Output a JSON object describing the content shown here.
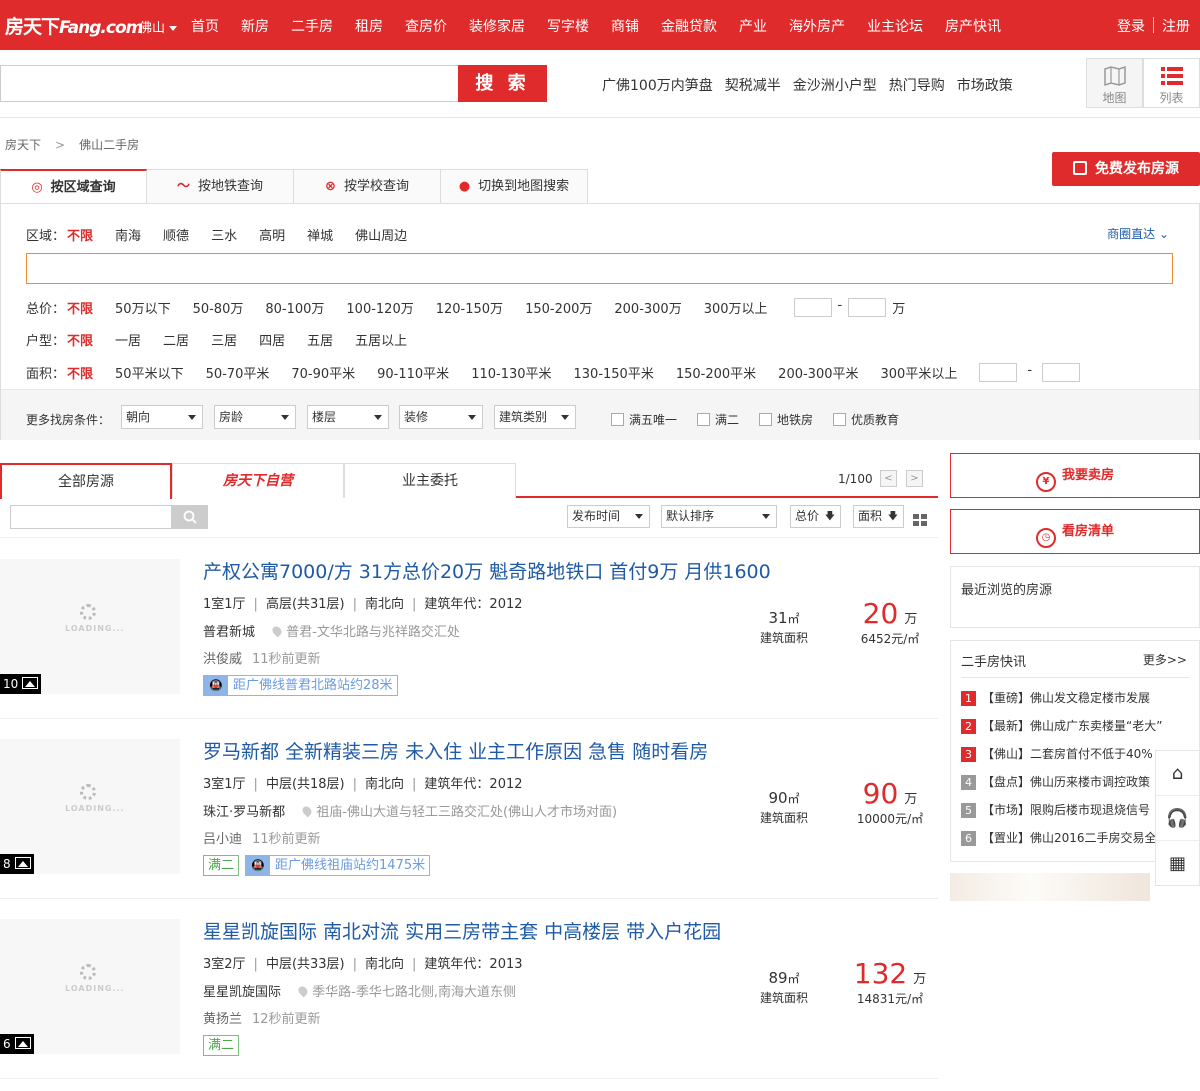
{
  "header": {
    "logo_main": "房天下",
    "logo_sub": "Fang.com",
    "city": "佛山",
    "nav": [
      "首页",
      "新房",
      "二手房",
      "租房",
      "查房价",
      "装修家居",
      "写字楼",
      "商铺",
      "金融贷款",
      "产业",
      "海外房产",
      "业主论坛",
      "房产快讯"
    ],
    "login": "登录",
    "register": "注册"
  },
  "search": {
    "placeholder": "",
    "button": "搜 索",
    "hot_links": [
      "广佛100万内笋盘",
      "契税减半",
      "金沙洲小户型",
      "热门导购",
      "市场政策"
    ],
    "view_map": "地图",
    "view_list": "列表"
  },
  "breadcrumb": [
    "房天下",
    "佛山二手房"
  ],
  "publish_button": "免费发布房源",
  "search_tabs": [
    "按区域查询",
    "按地铁查询",
    "按学校查询",
    "切换到地图搜索"
  ],
  "filters": {
    "district": {
      "label": "区域：",
      "options": [
        "不限",
        "南海",
        "顺德",
        "三水",
        "高明",
        "禅城",
        "佛山周边"
      ]
    },
    "shangquan": "商圈直达",
    "price": {
      "label": "总价：",
      "options": [
        "不限",
        "50万以下",
        "50-80万",
        "80-100万",
        "100-120万",
        "120-150万",
        "150-200万",
        "200-300万",
        "300万以上"
      ],
      "unit": "万",
      "dash": "-"
    },
    "layout": {
      "label": "户型：",
      "options": [
        "不限",
        "一居",
        "二居",
        "三居",
        "四居",
        "五居",
        "五居以上"
      ]
    },
    "area": {
      "label": "面积：",
      "options": [
        "不限",
        "50平米以下",
        "50-70平米",
        "70-90平米",
        "90-110平米",
        "110-130平米",
        "130-150平米",
        "150-200平米",
        "200-300平米",
        "300平米以上"
      ],
      "dash": "-"
    },
    "more_label": "更多找房条件：",
    "dropdowns": [
      "朝向",
      "房龄",
      "楼层",
      "装修",
      "建筑类别"
    ],
    "checkboxes": [
      "满五唯一",
      "满二",
      "地铁房",
      "优质教育"
    ]
  },
  "results": {
    "tabs": [
      "全部房源",
      "房天下自营",
      "业主委托"
    ],
    "pager": "1/100",
    "sort": [
      "发布时间",
      "默认排序",
      "总价",
      "面积"
    ],
    "listings": [
      {
        "title": "产权公寓7000/方 31方总价20万 魁奇路地铁口 首付9万 月供1600",
        "rooms": "1室1厅",
        "floor": "高层(共31层)",
        "facing": "南北向",
        "year": "建筑年代：2012",
        "estate": "普君新城",
        "address": "普君-文华北路与兆祥路交汇处",
        "agent": "洪俊威",
        "updated": "11秒前更新",
        "tags": [
          {
            "text": "距广佛线普君北路站约28米",
            "type": "subway"
          }
        ],
        "area": "31",
        "area_unit": "㎡",
        "area_label": "建筑面积",
        "price": "20",
        "price_unit": "万",
        "unit_price": "6452元/㎡",
        "photos": "10"
      },
      {
        "title": "罗马新都 全新精装三房 未入住 业主工作原因 急售 随时看房",
        "rooms": "3室1厅",
        "floor": "中层(共18层)",
        "facing": "南北向",
        "year": "建筑年代：2012",
        "estate": "珠江·罗马新都",
        "address": "祖庙-佛山大道与轻工三路交汇处(佛山人才市场对面)",
        "agent": "吕小迪",
        "updated": "11秒前更新",
        "tags": [
          {
            "text": "满二",
            "type": "green"
          },
          {
            "text": "距广佛线祖庙站约1475米",
            "type": "subway"
          }
        ],
        "area": "90",
        "area_unit": "㎡",
        "area_label": "建筑面积",
        "price": "90",
        "price_unit": "万",
        "unit_price": "10000元/㎡",
        "photos": "8"
      },
      {
        "title": "星星凯旋国际 南北对流 实用三房带主套 中高楼层 带入户花园",
        "rooms": "3室2厅",
        "floor": "中层(共33层)",
        "facing": "南北向",
        "year": "建筑年代：2013",
        "estate": "星星凯旋国际",
        "address": "季华路-季华七路北侧,南海大道东侧",
        "agent": "黄扬兰",
        "updated": "12秒前更新",
        "tags": [
          {
            "text": "满二",
            "type": "green"
          }
        ],
        "area": "89",
        "area_unit": "㎡",
        "area_label": "建筑面积",
        "price": "132",
        "price_unit": "万",
        "unit_price": "14831元/㎡",
        "photos": "6"
      }
    ],
    "loading_text": "LOADING..."
  },
  "sidebar": {
    "sell_button": "我要卖房",
    "watchlist_button": "看房清单",
    "recent_title": "最近浏览的房源",
    "news_title": "二手房快讯",
    "news_more": "更多>>",
    "news": [
      "【重磅】佛山发文稳定楼市发展",
      "【最新】佛山成广东卖楼量“老大”",
      "【佛山】二套房首付不低于40%",
      "【盘点】佛山历来楼市调控政策",
      "【市场】限购后楼市现退烧信号",
      "【置业】佛山2016二手房交易全"
    ]
  },
  "colors": {
    "brand": "#df2b2b",
    "link": "#1f5aa6",
    "accent_orange": "#f08c2a"
  }
}
